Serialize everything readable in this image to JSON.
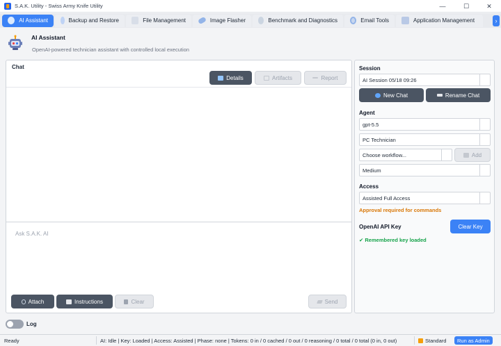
{
  "window": {
    "title": "S.A.K. Utility - Swiss Army Knife Utility",
    "controls": {
      "minimize": "—",
      "maximize": "☐",
      "close": "✕"
    }
  },
  "tabs": [
    {
      "label": "AI Assistant",
      "icon": "robot-icon",
      "active": true
    },
    {
      "label": "Backup and Restore",
      "icon": "backup-icon"
    },
    {
      "label": "File Management",
      "icon": "file-icon"
    },
    {
      "label": "Image Flasher",
      "icon": "flash-icon"
    },
    {
      "label": "Benchmark and Diagnostics",
      "icon": "gauge-icon"
    },
    {
      "label": "Email Tools",
      "icon": "email-icon"
    },
    {
      "label": "Application Management",
      "icon": "download-icon"
    }
  ],
  "tab_scroll": "›",
  "header": {
    "title": "AI Assistant",
    "subtitle": "OpenAI-powered technician assistant with controlled local execution"
  },
  "chat": {
    "label": "Chat",
    "details_label": "Details",
    "artifacts_label": "Artifacts",
    "report_label": "Report",
    "input_placeholder": "Ask S.A.K. AI",
    "attach_label": "Attach",
    "instructions_label": "Instructions",
    "clear_label": "Clear",
    "send_label": "Send"
  },
  "session": {
    "label": "Session",
    "current": "AI Session  05/18 09:26",
    "new_chat_label": "New Chat",
    "rename_chat_label": "Rename Chat"
  },
  "agent": {
    "label": "Agent",
    "model": "gpt-5.5",
    "persona": "PC Technician",
    "workflow_placeholder": "Choose workflow...",
    "add_label": "Add",
    "effort": "Medium"
  },
  "access": {
    "label": "Access",
    "mode": "Assisted Full Access",
    "note": "Approval required for commands"
  },
  "api_key": {
    "label": "OpenAI API Key",
    "clear_label": "Clear Key",
    "status": "Remembered key loaded"
  },
  "log": {
    "label": "Log",
    "enabled": false
  },
  "statusbar": {
    "ready": "Ready",
    "stats": "AI: Idle | Key: Loaded | Access: Assisted | Phase: none | Tokens: 0 in / 0 cached / 0 out / 0 reasoning / 0 total / 0 total (0 in, 0 out)",
    "mode": "Standard",
    "admin_label": "Run as Admin"
  },
  "colors": {
    "accent": "#3b82f6",
    "dark_button": "#4b5563",
    "warning": "#d97706",
    "success": "#16a34a"
  }
}
